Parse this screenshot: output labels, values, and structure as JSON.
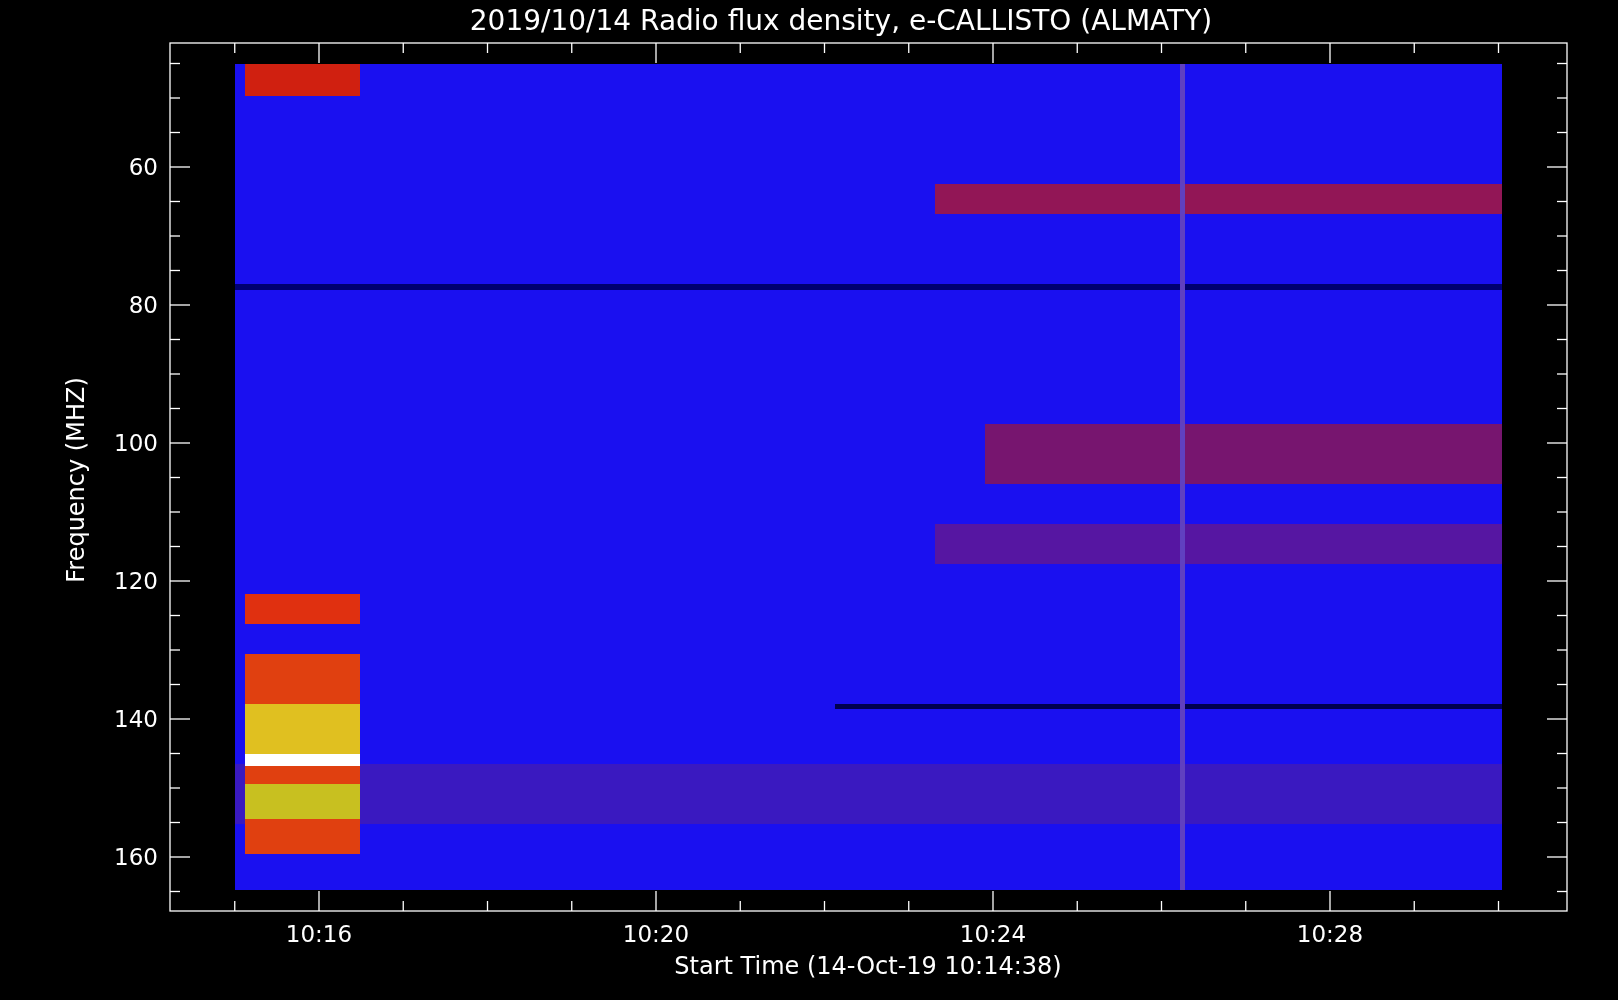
{
  "title": "2019/10/14  Radio flux density, e-CALLISTO (ALMATY)",
  "y_axis": {
    "label": "Frequency (MHZ)",
    "ticks": [
      "60",
      "80",
      "100",
      "120",
      "140",
      "160"
    ]
  },
  "x_axis": {
    "label": "Start Time (14-Oct-19 10:14:38)",
    "ticks": [
      "10:16",
      "10:20",
      "10:24",
      "10:28"
    ]
  }
}
